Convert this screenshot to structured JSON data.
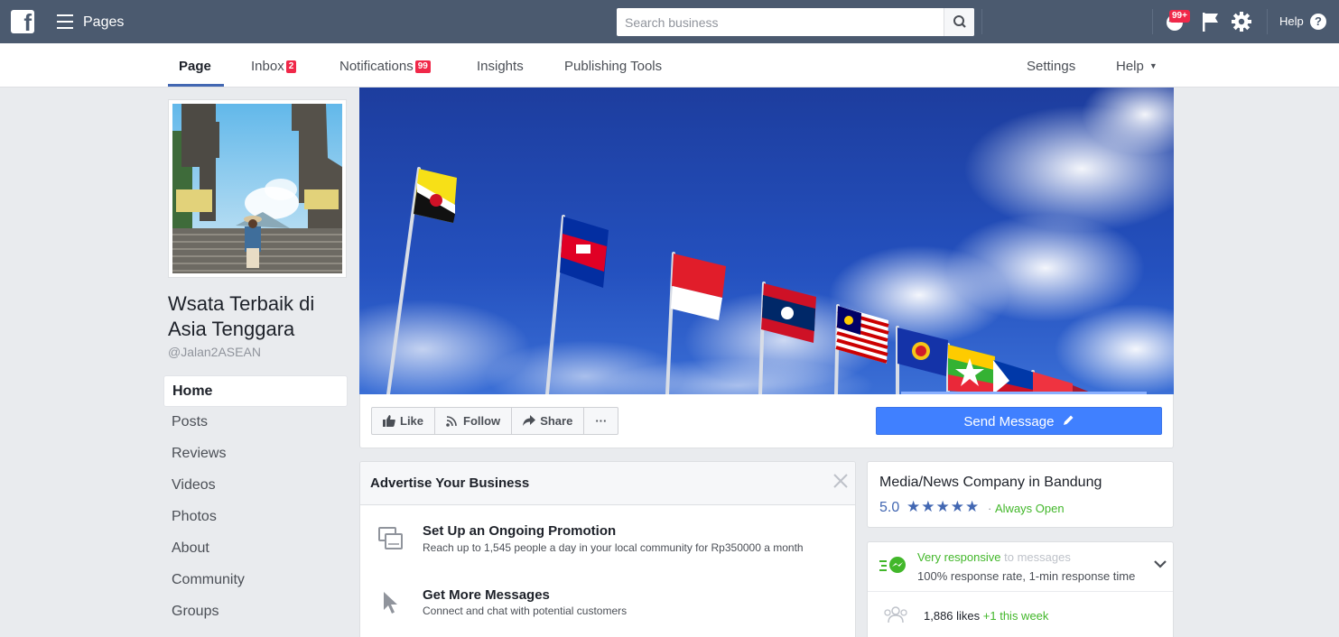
{
  "topbar": {
    "logo": "f",
    "app_title": "Pages",
    "search_placeholder": "Search business",
    "notification_badge": "99+",
    "help_label": "Help",
    "help_glyph": "?"
  },
  "pagenav": {
    "page": "Page",
    "inbox": "Inbox",
    "inbox_badge": "2",
    "notifications": "Notifications",
    "notifications_badge": "99",
    "insights": "Insights",
    "publishing_tools": "Publishing Tools",
    "settings": "Settings",
    "help": "Help"
  },
  "profile": {
    "name": "Wsata Terbaik di Asia Tenggara",
    "handle": "@Jalan2ASEAN"
  },
  "sidenav": {
    "items": [
      {
        "label": "Home"
      },
      {
        "label": "Posts"
      },
      {
        "label": "Reviews"
      },
      {
        "label": "Videos"
      },
      {
        "label": "Photos"
      },
      {
        "label": "About"
      },
      {
        "label": "Community"
      },
      {
        "label": "Groups"
      }
    ]
  },
  "actions": {
    "like": "Like",
    "follow": "Follow",
    "share": "Share",
    "more": "···",
    "send_message": "Send Message"
  },
  "advertise": {
    "title": "Advertise Your Business",
    "rows": [
      {
        "title": "Set Up an Ongoing Promotion",
        "subtitle": "Reach up to 1,545 people a day in your local community for Rp350000 a month"
      },
      {
        "title": "Get More Messages",
        "subtitle": "Connect and chat with potential customers"
      }
    ]
  },
  "info": {
    "category": "Media/News Company in Bandung",
    "rating": "5.0",
    "stars": "★★★★★",
    "separator": "·",
    "open_status": "Always Open"
  },
  "response": {
    "responsive": "Very responsive",
    "to_messages": "to messages",
    "rate_text": "100% response rate, 1-min response time",
    "likes_count": "1,886 likes",
    "likes_week": "+1 this week"
  },
  "colors": {
    "topbar": "#4b5a6f",
    "accent": "#4267b2",
    "send_button": "#4080ff",
    "badge": "#f02849",
    "green": "#42b72a"
  }
}
